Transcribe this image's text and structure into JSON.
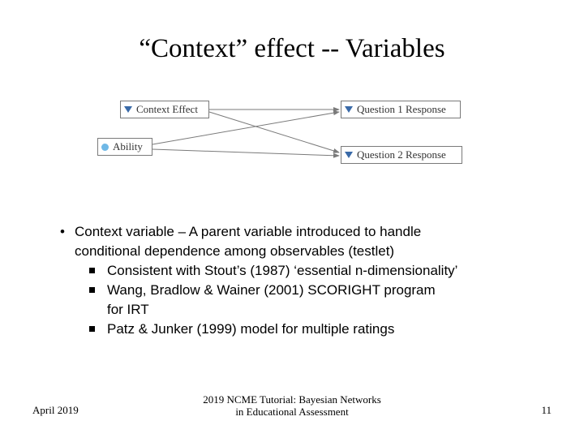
{
  "title": "“Context” effect -- Variables",
  "diagram": {
    "nodes": {
      "context": {
        "label": "Context Effect"
      },
      "ability": {
        "label": "Ability"
      },
      "q1": {
        "label": "Question 1 Response"
      },
      "q2": {
        "label": "Question 2 Response"
      }
    }
  },
  "bullets": {
    "l1a": "Context variable – A parent variable introduced to handle",
    "l1b": "conditional dependence among observables (testlet)",
    "s1": "Consistent with Stout’s (1987) ‘essential n-dimensionality’",
    "s2a": "Wang, Bradlow & Wainer (2001) SCORIGHT program",
    "s2b": " for IRT",
    "s3": "Patz & Junker (1999) model for multiple ratings"
  },
  "footer": {
    "date": "April 2019",
    "center_line1": "2019 NCME Tutorial: Bayesian Networks",
    "center_line2": "in Educational Assessment",
    "page": "11"
  }
}
